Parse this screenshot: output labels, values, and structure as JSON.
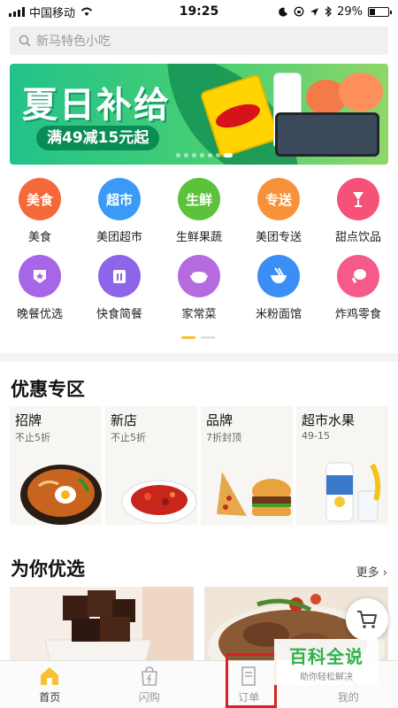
{
  "status_bar": {
    "carrier": "中国移动",
    "time": "19:25",
    "battery": "29%",
    "battery_level": 0.29
  },
  "search": {
    "placeholder": "新马特色小吃",
    "icon": "search-icon"
  },
  "banner": {
    "title": "夏日补给",
    "tag": "满49减15元起",
    "slide_count": 7,
    "active_slide": 6
  },
  "categories": [
    {
      "label": "美食",
      "badge": "美食",
      "color": "#f5683a",
      "icon": "food-icon"
    },
    {
      "label": "美团超市",
      "badge": "超市",
      "color": "#3a9af5",
      "icon": "supermarket-icon"
    },
    {
      "label": "生鲜果蔬",
      "badge": "生鲜",
      "color": "#5bc23a",
      "icon": "produce-icon"
    },
    {
      "label": "美团专送",
      "badge": "专送",
      "color": "#f7923a",
      "icon": "delivery-icon"
    },
    {
      "label": "甜点饮品",
      "badge": "",
      "color": "#f5527a",
      "icon": "drink-icon"
    },
    {
      "label": "晚餐优选",
      "badge": "",
      "color": "#a765e8",
      "icon": "dinner-icon"
    },
    {
      "label": "快食简餐",
      "badge": "",
      "color": "#8c65e8",
      "icon": "fastfood-icon"
    },
    {
      "label": "家常菜",
      "badge": "",
      "color": "#b46be0",
      "icon": "homecook-icon"
    },
    {
      "label": "米粉面馆",
      "badge": "",
      "color": "#3a8ef5",
      "icon": "noodle-icon"
    },
    {
      "label": "炸鸡零食",
      "badge": "",
      "color": "#f55a8a",
      "icon": "chicken-icon"
    }
  ],
  "promo": {
    "title": "优惠专区",
    "cards": [
      {
        "title": "招牌",
        "sub": "不止5折"
      },
      {
        "title": "新店",
        "sub": "不止5折"
      },
      {
        "title": "品牌",
        "sub": "7折封顶"
      },
      {
        "title": "超市水果",
        "sub": "49-15"
      }
    ]
  },
  "picks": {
    "title": "为你优选",
    "more": "更多 ›"
  },
  "tabs": [
    {
      "label": "首页",
      "icon": "home-icon",
      "active": true
    },
    {
      "label": "闪购",
      "icon": "flash-bag-icon",
      "active": false
    },
    {
      "label": "订单",
      "icon": "order-icon",
      "active": false
    },
    {
      "label": "我的",
      "icon": "profile-icon",
      "active": false
    }
  ],
  "watermark": {
    "main": "百科全说",
    "sub": "助你轻松解决"
  },
  "colors": {
    "accent": "#f9c033",
    "highlight": "#d92121",
    "watermark_green": "#2db34a"
  }
}
